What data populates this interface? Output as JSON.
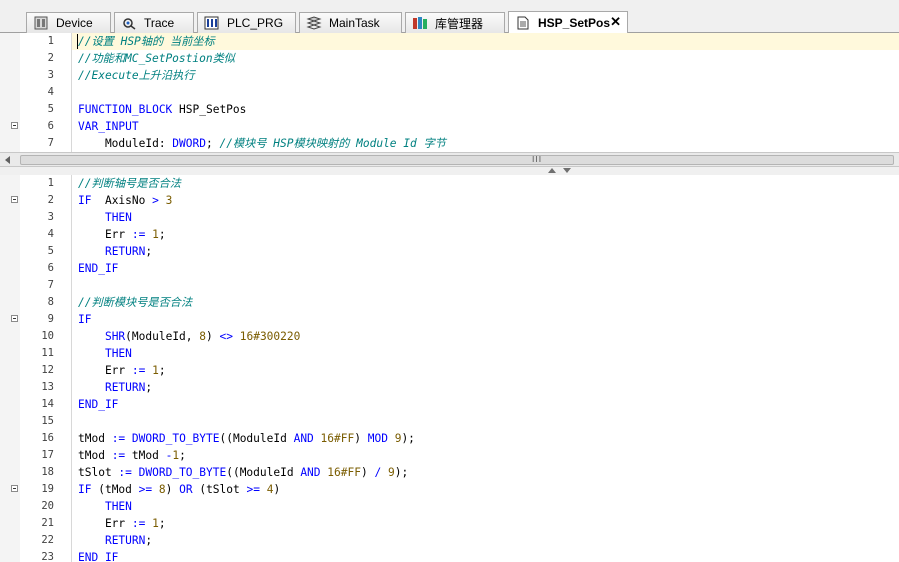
{
  "tabs": [
    {
      "label": "Device",
      "icon": "device-icon",
      "active": false
    },
    {
      "label": "Trace",
      "icon": "trace-icon",
      "active": false
    },
    {
      "label": "PLC_PRG",
      "icon": "pou-icon",
      "active": false
    },
    {
      "label": "MainTask",
      "icon": "task-icon",
      "active": false
    },
    {
      "label": "库管理器",
      "icon": "library-icon",
      "active": false
    },
    {
      "label": "HSP_SetPos",
      "icon": "document-icon",
      "active": true,
      "close": "✕"
    }
  ],
  "colors": {
    "keyword": "#0000ff",
    "comment": "#008080",
    "number": "#7a5c00",
    "current_line": "#fff9dc"
  },
  "declaration_pane": {
    "lines": [
      {
        "num": "1",
        "fold": false,
        "tokens": [
          {
            "t": "cm",
            "v": "//设置 HSP轴的 当前坐标"
          }
        ]
      },
      {
        "num": "2",
        "fold": false,
        "tokens": [
          {
            "t": "cm",
            "v": "//功能和MC_SetPostion类似"
          }
        ]
      },
      {
        "num": "3",
        "fold": false,
        "tokens": [
          {
            "t": "cm",
            "v": "//Execute上升沿执行"
          }
        ]
      },
      {
        "num": "4",
        "fold": false,
        "tokens": []
      },
      {
        "num": "5",
        "fold": false,
        "tokens": [
          {
            "t": "kw",
            "v": "FUNCTION_BLOCK"
          },
          {
            "t": "pl",
            "v": " HSP_SetPos"
          }
        ]
      },
      {
        "num": "6",
        "fold": true,
        "tokens": [
          {
            "t": "kw",
            "v": "VAR_INPUT"
          }
        ]
      },
      {
        "num": "7",
        "fold": false,
        "tokens": [
          {
            "t": "pl",
            "v": "    ModuleId: "
          },
          {
            "t": "kw",
            "v": "DWORD"
          },
          {
            "t": "pl",
            "v": "; "
          },
          {
            "t": "cm",
            "v": "//模块号 HSP模块映射的 Module Id 字节"
          }
        ]
      }
    ]
  },
  "implementation_pane": {
    "lines": [
      {
        "num": "1",
        "fold": false,
        "tokens": [
          {
            "t": "cm",
            "v": "//判断轴号是否合法"
          }
        ]
      },
      {
        "num": "2",
        "fold": true,
        "tokens": [
          {
            "t": "kw",
            "v": "IF"
          },
          {
            "t": "pl",
            "v": "  AxisNo "
          },
          {
            "t": "kw",
            "v": ">"
          },
          {
            "t": "pl",
            "v": " "
          },
          {
            "t": "num",
            "v": "3"
          }
        ]
      },
      {
        "num": "3",
        "fold": false,
        "tokens": [
          {
            "t": "pl",
            "v": "    "
          },
          {
            "t": "kw",
            "v": "THEN"
          }
        ]
      },
      {
        "num": "4",
        "fold": false,
        "tokens": [
          {
            "t": "pl",
            "v": "    Err "
          },
          {
            "t": "kw",
            "v": ":="
          },
          {
            "t": "pl",
            "v": " "
          },
          {
            "t": "num",
            "v": "1"
          },
          {
            "t": "pl",
            "v": ";"
          }
        ]
      },
      {
        "num": "5",
        "fold": false,
        "tokens": [
          {
            "t": "pl",
            "v": "    "
          },
          {
            "t": "kw",
            "v": "RETURN"
          },
          {
            "t": "pl",
            "v": ";"
          }
        ]
      },
      {
        "num": "6",
        "fold": false,
        "tokens": [
          {
            "t": "kw",
            "v": "END_IF"
          }
        ]
      },
      {
        "num": "7",
        "fold": false,
        "tokens": []
      },
      {
        "num": "8",
        "fold": false,
        "tokens": [
          {
            "t": "cm",
            "v": "//判断模块号是否合法"
          }
        ]
      },
      {
        "num": "9",
        "fold": true,
        "tokens": [
          {
            "t": "kw",
            "v": "IF"
          }
        ]
      },
      {
        "num": "10",
        "fold": false,
        "tokens": [
          {
            "t": "pl",
            "v": "    "
          },
          {
            "t": "kw",
            "v": "SHR"
          },
          {
            "t": "pl",
            "v": "(ModuleId, "
          },
          {
            "t": "num",
            "v": "8"
          },
          {
            "t": "pl",
            "v": ") "
          },
          {
            "t": "kw",
            "v": "<>"
          },
          {
            "t": "pl",
            "v": " "
          },
          {
            "t": "num",
            "v": "16#300220"
          }
        ]
      },
      {
        "num": "11",
        "fold": false,
        "tokens": [
          {
            "t": "pl",
            "v": "    "
          },
          {
            "t": "kw",
            "v": "THEN"
          }
        ]
      },
      {
        "num": "12",
        "fold": false,
        "tokens": [
          {
            "t": "pl",
            "v": "    Err "
          },
          {
            "t": "kw",
            "v": ":="
          },
          {
            "t": "pl",
            "v": " "
          },
          {
            "t": "num",
            "v": "1"
          },
          {
            "t": "pl",
            "v": ";"
          }
        ]
      },
      {
        "num": "13",
        "fold": false,
        "tokens": [
          {
            "t": "pl",
            "v": "    "
          },
          {
            "t": "kw",
            "v": "RETURN"
          },
          {
            "t": "pl",
            "v": ";"
          }
        ]
      },
      {
        "num": "14",
        "fold": false,
        "tokens": [
          {
            "t": "kw",
            "v": "END_IF"
          }
        ]
      },
      {
        "num": "15",
        "fold": false,
        "tokens": []
      },
      {
        "num": "16",
        "fold": false,
        "tokens": [
          {
            "t": "pl",
            "v": "tMod "
          },
          {
            "t": "kw",
            "v": ":="
          },
          {
            "t": "pl",
            "v": " "
          },
          {
            "t": "kw",
            "v": "DWORD_TO_BYTE"
          },
          {
            "t": "pl",
            "v": "((ModuleId "
          },
          {
            "t": "kw",
            "v": "AND"
          },
          {
            "t": "pl",
            "v": " "
          },
          {
            "t": "num",
            "v": "16#FF"
          },
          {
            "t": "pl",
            "v": ") "
          },
          {
            "t": "kw",
            "v": "MOD"
          },
          {
            "t": "pl",
            "v": " "
          },
          {
            "t": "num",
            "v": "9"
          },
          {
            "t": "pl",
            "v": ");"
          }
        ]
      },
      {
        "num": "17",
        "fold": false,
        "tokens": [
          {
            "t": "pl",
            "v": "tMod "
          },
          {
            "t": "kw",
            "v": ":="
          },
          {
            "t": "pl",
            "v": " tMod "
          },
          {
            "t": "kw",
            "v": "-"
          },
          {
            "t": "num",
            "v": "1"
          },
          {
            "t": "pl",
            "v": ";"
          }
        ]
      },
      {
        "num": "18",
        "fold": false,
        "tokens": [
          {
            "t": "pl",
            "v": "tSlot "
          },
          {
            "t": "kw",
            "v": ":="
          },
          {
            "t": "pl",
            "v": " "
          },
          {
            "t": "kw",
            "v": "DWORD_TO_BYTE"
          },
          {
            "t": "pl",
            "v": "((ModuleId "
          },
          {
            "t": "kw",
            "v": "AND"
          },
          {
            "t": "pl",
            "v": " "
          },
          {
            "t": "num",
            "v": "16#FF"
          },
          {
            "t": "pl",
            "v": ") "
          },
          {
            "t": "kw",
            "v": "/"
          },
          {
            "t": "pl",
            "v": " "
          },
          {
            "t": "num",
            "v": "9"
          },
          {
            "t": "pl",
            "v": ");"
          }
        ]
      },
      {
        "num": "19",
        "fold": true,
        "tokens": [
          {
            "t": "kw",
            "v": "IF"
          },
          {
            "t": "pl",
            "v": " (tMod "
          },
          {
            "t": "kw",
            "v": ">="
          },
          {
            "t": "pl",
            "v": " "
          },
          {
            "t": "num",
            "v": "8"
          },
          {
            "t": "pl",
            "v": ") "
          },
          {
            "t": "kw",
            "v": "OR"
          },
          {
            "t": "pl",
            "v": " (tSlot "
          },
          {
            "t": "kw",
            "v": ">="
          },
          {
            "t": "pl",
            "v": " "
          },
          {
            "t": "num",
            "v": "4"
          },
          {
            "t": "pl",
            "v": ")"
          }
        ]
      },
      {
        "num": "20",
        "fold": false,
        "tokens": [
          {
            "t": "pl",
            "v": "    "
          },
          {
            "t": "kw",
            "v": "THEN"
          }
        ]
      },
      {
        "num": "21",
        "fold": false,
        "tokens": [
          {
            "t": "pl",
            "v": "    Err "
          },
          {
            "t": "kw",
            "v": ":="
          },
          {
            "t": "pl",
            "v": " "
          },
          {
            "t": "num",
            "v": "1"
          },
          {
            "t": "pl",
            "v": ";"
          }
        ]
      },
      {
        "num": "22",
        "fold": false,
        "tokens": [
          {
            "t": "pl",
            "v": "    "
          },
          {
            "t": "kw",
            "v": "RETURN"
          },
          {
            "t": "pl",
            "v": ";"
          }
        ]
      },
      {
        "num": "23",
        "fold": false,
        "tokens": [
          {
            "t": "kw",
            "v": "END_IF"
          }
        ]
      }
    ]
  },
  "scrollbar": {
    "grip": "III"
  }
}
